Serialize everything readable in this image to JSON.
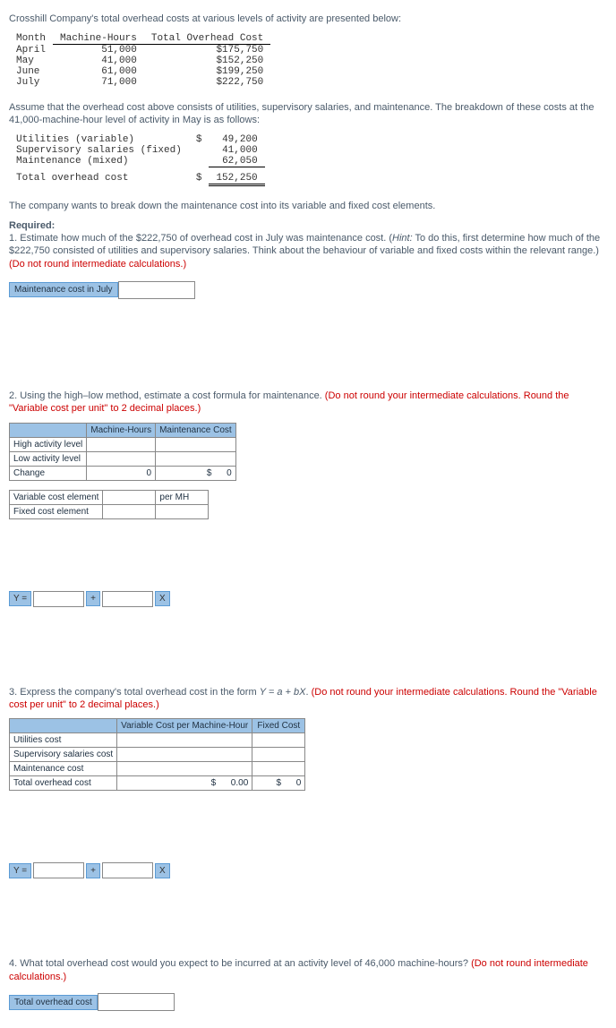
{
  "intro": "Crosshill Company's total overhead costs at various levels of activity are presented below:",
  "table1": {
    "headers": [
      "Month",
      "Machine-Hours",
      "Total Overhead Cost"
    ],
    "rows": [
      [
        "April",
        "51,000",
        "$175,750"
      ],
      [
        "May",
        "41,000",
        "$152,250"
      ],
      [
        "June",
        "61,000",
        "$199,250"
      ],
      [
        "July",
        "71,000",
        "$222,750"
      ]
    ]
  },
  "assume": "Assume that the overhead cost above consists of utilities, supervisory salaries, and maintenance. The breakdown of these costs at the 41,000-machine-hour level of activity in May is as follows:",
  "table2": {
    "rows": [
      [
        "Utilities (variable)",
        "$",
        "49,200"
      ],
      [
        "Supervisory salaries (fixed)",
        "",
        "41,000"
      ],
      [
        "Maintenance (mixed)",
        "",
        "62,050"
      ]
    ],
    "total": {
      "label": "Total overhead cost",
      "currency": "$",
      "value": "152,250"
    }
  },
  "break_text": "The company wants to break down the maintenance cost into its variable and fixed cost elements.",
  "required_label": "Required:",
  "q1": {
    "text_pre": "1. Estimate how much of the $222,750 of overhead cost in July was maintenance cost. (",
    "hint_label": "Hint:",
    "text_mid": " To do this, first determine how much of the $222,750 consisted of utilities and supervisory salaries. Think about the behaviour of variable and fixed costs within the relevant range.) ",
    "red": "(Do not round intermediate calculations.)",
    "input_label": "Maintenance cost in July"
  },
  "q2": {
    "text": "2. Using the high–low method, estimate a cost formula for maintenance. ",
    "red": "(Do not round your intermediate calculations. Round the \"Variable cost per unit\" to 2 decimal places.)",
    "headers": [
      "",
      "Machine-Hours",
      "Maintenance Cost"
    ],
    "row_labels": [
      "High activity level",
      "Low activity level",
      "Change"
    ],
    "change_mh": "0",
    "change_cost_prefix": "$",
    "change_cost": "0",
    "row_labels2": [
      "Variable cost element",
      "Fixed cost element"
    ],
    "per_mh": "per MH",
    "y_label": "Y =",
    "plus": "+",
    "x_label": "X"
  },
  "q3": {
    "text_pre": "3. Express the company's total overhead cost in the form ",
    "formula": "Y = a + bX",
    "text_post": ". ",
    "red": "(Do not round your intermediate calculations. Round the \"Variable cost per unit\" to 2 decimal places.)",
    "headers": [
      "",
      "Variable Cost per Machine-Hour",
      "Fixed Cost"
    ],
    "row_labels": [
      "Utilities cost",
      "Supervisory salaries cost",
      "Maintenance cost",
      "Total overhead cost"
    ],
    "total_vc_prefix": "$",
    "total_vc": "0.00",
    "total_fc_prefix": "$",
    "total_fc": "0",
    "y_label": "Y =",
    "plus": "+",
    "x_label": "X"
  },
  "q4": {
    "text": "4. What total overhead cost would you expect to be incurred at an activity level of 46,000 machine-hours? ",
    "red": "(Do not round intermediate calculations.)",
    "input_label": "Total overhead cost"
  }
}
